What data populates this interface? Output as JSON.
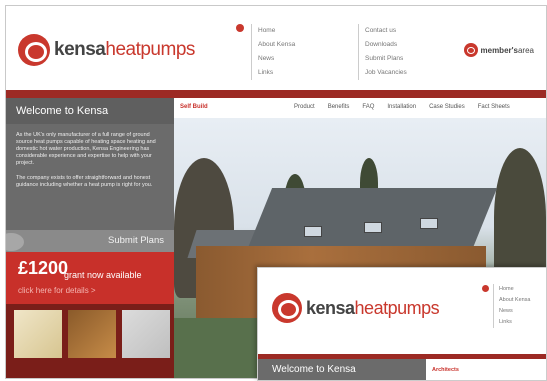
{
  "brand": {
    "name_part1": "kensa",
    "name_part2": "heatpumps"
  },
  "nav": {
    "col1": [
      "Home",
      "About Kensa",
      "News",
      "Links"
    ],
    "col2": [
      "Contact us",
      "Downloads",
      "Submit Plans",
      "Job Vacancies"
    ]
  },
  "members": {
    "label_bold": "member's",
    "label": "area"
  },
  "left": {
    "welcome": "Welcome to Kensa",
    "intro_p1": "As the UK's only manufacturer of a full range of ground source heat pumps capable of heating space heating and domestic hot water production, Kensa Engineering has considerable experience and expertise to help with your project.",
    "intro_p2": "The company exists to offer straightforward and honest guidance including whether a heat pump is right for you.",
    "submit": "Submit Plans",
    "grant_amount": "£1200",
    "grant_text": "grant now available",
    "grant_link": "click here for details >"
  },
  "subnav": {
    "section": "Self Build",
    "links": [
      "Product",
      "Benefits",
      "FAQ",
      "Installation",
      "Case Studies",
      "Fact Sheets"
    ]
  },
  "inset": {
    "nav": [
      "Home",
      "About Kensa",
      "News",
      "Links"
    ],
    "welcome": "Welcome to Kensa",
    "section": "Architects"
  },
  "colors": {
    "brand_red": "#c8302a",
    "dark_red": "#9c2a24",
    "grey_panel": "#6b6b6b"
  }
}
